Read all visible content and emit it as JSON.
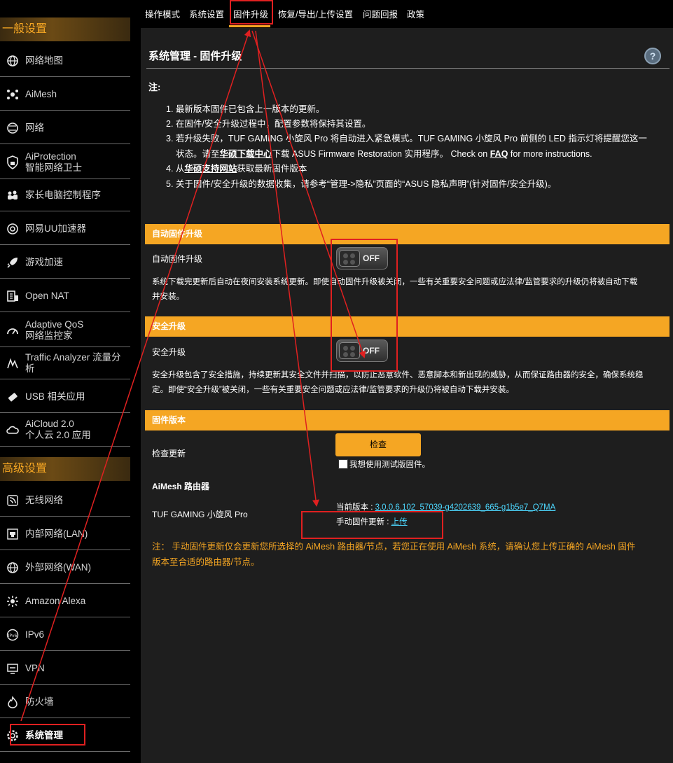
{
  "sidebar": {
    "general_header": "一般设置",
    "advanced_header": "高级设置",
    "general_items": [
      {
        "label": "网络地图",
        "icon": "globe-icon"
      },
      {
        "label": "AiMesh",
        "icon": "mesh-icon"
      },
      {
        "label": "网络",
        "icon": "network-icon"
      },
      {
        "label": "AiProtection",
        "label2": "智能网络卫士",
        "icon": "shield-lock-icon"
      },
      {
        "label": "家长电脑控制程序",
        "icon": "family-icon"
      },
      {
        "label": "网易UU加速器",
        "icon": "accelerator-icon"
      },
      {
        "label": "游戏加速",
        "icon": "rocket-icon"
      },
      {
        "label": "Open NAT",
        "icon": "open-nat-icon"
      },
      {
        "label": "Adaptive QoS",
        "label2": "网络监控家",
        "icon": "gauge-icon"
      },
      {
        "label": "Traffic Analyzer 流量分析",
        "icon": "traffic-icon"
      },
      {
        "label": "USB 相关应用",
        "icon": "usb-icon"
      },
      {
        "label": "AiCloud 2.0",
        "label2": "个人云 2.0 应用",
        "icon": "cloud-icon"
      }
    ],
    "advanced_items": [
      {
        "label": "无线网络",
        "icon": "wireless-icon"
      },
      {
        "label": "内部网络(LAN)",
        "icon": "lan-icon"
      },
      {
        "label": "外部网络(WAN)",
        "icon": "wan-globe-icon"
      },
      {
        "label": "Amazon Alexa",
        "icon": "alexa-icon"
      },
      {
        "label": "IPv6",
        "icon": "ipv6-icon"
      },
      {
        "label": "VPN",
        "icon": "vpn-icon"
      },
      {
        "label": "防火墙",
        "icon": "firewall-icon"
      },
      {
        "label": "系统管理",
        "icon": "gear-icon"
      }
    ]
  },
  "tabs": [
    "操作模式",
    "系统设置",
    "固件升级",
    "恢复/导出/上传设置",
    "问题回报",
    "政策"
  ],
  "page": {
    "title": "系统管理 - 固件升级",
    "help": "?",
    "note_label": "注:",
    "notes": {
      "n1": "1. 最新版本固件已包含上一版本的更新。",
      "n2": "2. 在固件/安全升级过程中，配置参数将保持其设置。",
      "n3a": "3. 若升级失败，TUF GAMING 小旋风 Pro 将自动进入紧急模式。TUF GAMING 小旋风 Pro 前侧的 LED 指示灯将提醒您这一",
      "n3b_pre": "状态。请至",
      "n3b_link": "华硕下载中心",
      "n3b_mid": "下载 ASUS Firmware Restoration 实用程序。 Check on ",
      "n3b_faq": "FAQ",
      "n3b_post": " for more instructions.",
      "n4_pre": "4. 从",
      "n4_link": "华硕支持网站",
      "n4_post": "获取最新固件版本",
      "n5": "5. 关于固件/安全升级的数据收集，请参考“管理->隐私”页面的“ASUS 隐私声明”(针对固件/安全升级)。"
    }
  },
  "auto_upgrade": {
    "bar": "自动固件升级",
    "label": "自动固件升级",
    "toggle": "OFF",
    "desc1": "系统下载完更新后自动在夜间安装系统更新。即使自动固件升级被关闭，一些有关重要安全问题或应法律/监管要求的升级仍将被自动下载",
    "desc2": "并安装。"
  },
  "security_upgrade": {
    "bar": "安全升级",
    "label": "安全升级",
    "toggle": "OFF",
    "desc1": "安全升级包含了安全措施，持续更新其安全文件并扫描，以防止恶意软件、恶意脚本和新出现的威胁，从而保证路由器的安全，确保系统稳",
    "desc2": "定。即使“安全升级”被关闭，一些有关重要安全问题或应法律/监管要求的升级仍将被自动下载并安装。"
  },
  "firmware": {
    "bar": "固件版本",
    "check_label": "检查更新",
    "check_button": "检查",
    "beta_label": "我想使用测试版固件。",
    "aimesh_header": "AiMesh 路由器",
    "model": "TUF GAMING 小旋风 Pro",
    "current_version_label": "当前版本 : ",
    "current_version": "3.0.0.6.102_57039-g4202639_665-g1b5e7_Q7MA",
    "manual_label": "手动固件更新 : ",
    "manual_link": "上传",
    "warning1": "注： 手动固件更新仅会更新您所选择的 AiMesh 路由器/节点，若您正在使用 AiMesh 系统，请确认您上传正确的 AiMesh 固件",
    "warning2": "版本至合适的路由器/节点。"
  },
  "colors": {
    "accent": "#f5a623",
    "annotation": "#e02020",
    "link": "#4dd8ff"
  }
}
